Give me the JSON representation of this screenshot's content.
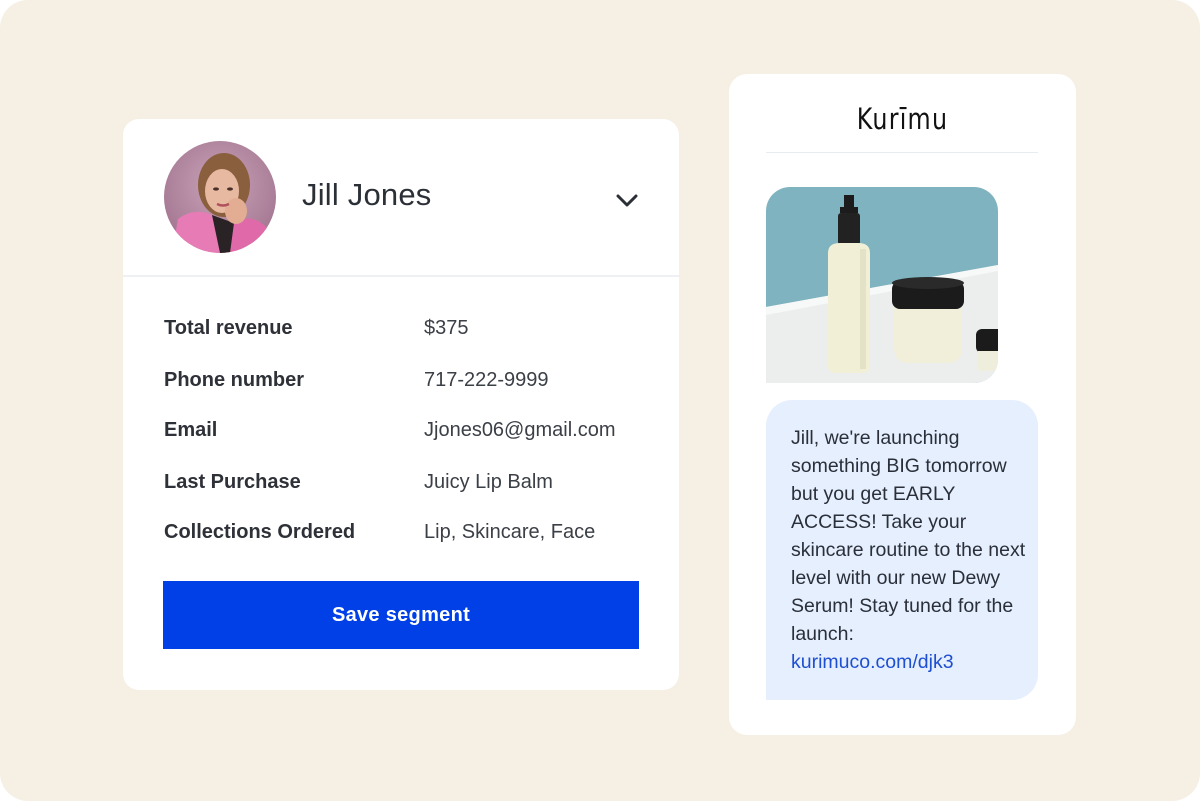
{
  "colors": {
    "background": "#f5efe4",
    "card": "#ffffff",
    "primary_button": "#0040e6",
    "message_bubble": "#e5effd",
    "link": "#1f4fd1"
  },
  "profile": {
    "name": "Jill Jones",
    "avatar_icon": "user-photo",
    "expand_icon": "chevron-down-icon",
    "details": [
      {
        "label": "Total revenue",
        "value": "$375"
      },
      {
        "label": "Phone number",
        "value": "717-222-9999"
      },
      {
        "label": "Email",
        "value": "Jjones06@gmail.com"
      },
      {
        "label": "Last Purchase",
        "value": "Juicy Lip Balm"
      },
      {
        "label": "Collections Ordered",
        "value": "Lip, Skincare, Face"
      }
    ],
    "save_label": "Save segment"
  },
  "message": {
    "brand": "Kurīmu",
    "text": "Jill, we're launching something BIG tomorrow but you get EARLY ACCESS! Take your skincare routine to the next level with our new Dewy Serum! Stay tuned for the launch:",
    "link": "kurimuco.com/djk3"
  }
}
